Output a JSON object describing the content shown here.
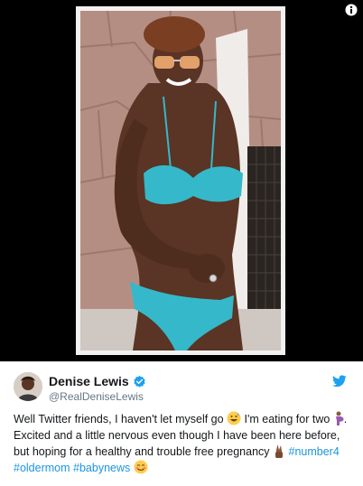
{
  "media": {
    "info_icon": "info-icon",
    "photo_alt": "photo"
  },
  "tweet": {
    "display_name": "Denise Lewis",
    "handle": "@RealDeniseLewis",
    "verified_icon": "verified-badge-icon",
    "brand_icon": "twitter-bird-icon",
    "colors": {
      "link": "#1b95e0",
      "verified": "#1da1f2",
      "muted": "#657786"
    },
    "text": {
      "part1": "Well Twitter friends, I haven't let myself go ",
      "part2": " I'm eating for two ",
      "part3": ". Excited and a little nervous even though I have been here before, but hoping for a healthy and trouble free pregnancy ",
      "hashtag1": "#number4",
      "hashtag2": "#oldermom",
      "hashtag3": "#babynews"
    },
    "emojis": [
      "grinning-sweat-face",
      "pregnant-woman",
      "crossed-fingers",
      "smiling-blushing-face"
    ]
  }
}
